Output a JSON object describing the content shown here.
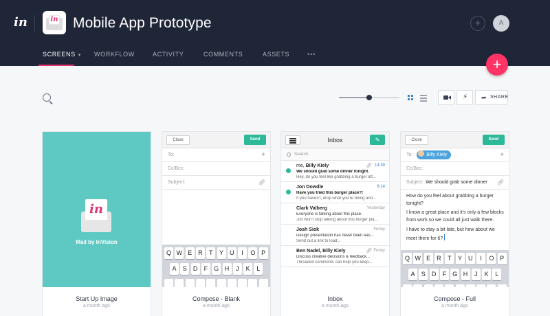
{
  "header": {
    "logo_text": "in",
    "app_icon_letter": "in",
    "title": "Mobile App Prototype",
    "plus_label": "+",
    "avatar_initial": "A"
  },
  "nav": {
    "items": [
      {
        "label": "SCREENS",
        "active": true
      },
      {
        "label": "WORKFLOW",
        "active": false
      },
      {
        "label": "ACTIVITY",
        "active": false
      },
      {
        "label": "COMMENTS",
        "active": false
      },
      {
        "label": "ASSETS",
        "active": false
      }
    ],
    "more_label": "•••",
    "dropdown_glyph": "▾"
  },
  "fab": {
    "label": "+"
  },
  "toolbar": {
    "zoom_level": 0.5,
    "view_mode": "grid",
    "share_label": "SHARE",
    "icons": [
      "search-icon",
      "grid-view-icon",
      "list-view-icon",
      "video-icon",
      "lightning-icon",
      "share-arrow-icon"
    ]
  },
  "colors": {
    "header_bg": "#1f2637",
    "accent": "#e0336f",
    "fab": "#ff3366",
    "teal": "#5ec9c3",
    "send_green": "#2bb99a",
    "chip_blue": "#4aa3df"
  },
  "cards": [
    {
      "title": "Start Up Image",
      "meta": "a month ago",
      "splash_letter": "in",
      "splash_label": "Mail by InVision"
    },
    {
      "title": "Compose - Blank",
      "meta": "a month ago",
      "close_label": "Close",
      "send_label": "Send",
      "to_label": "To:",
      "cc_label": "Cc/Bcc:",
      "subject_label": "Subject:"
    },
    {
      "title": "Inbox",
      "meta": "a month ago",
      "header_title": "Inbox",
      "search_placeholder": "Search",
      "emails": [
        {
          "from_prefix": "me, ",
          "from": "Billy Kiely",
          "time": "14:39",
          "subject": "We should grab some dinner tonight.",
          "preview": "Hey, do you feel like grabbing a burger aft...",
          "unread": true,
          "attachment": true
        },
        {
          "from_prefix": "",
          "from": "Jon Dowdle",
          "time": "8:14",
          "subject": "Have you tried this burger place?!",
          "preview": "If you haven't, drop what you're doing and...",
          "unread": true,
          "attachment": false
        },
        {
          "from_prefix": "",
          "from": "Clark Valberg",
          "time": "Yesterday",
          "subject": "Everyone is talking about this place.",
          "preview": "Jon won't stop talking about this burger pla...",
          "unread": false,
          "attachment": false
        },
        {
          "from_prefix": "",
          "from": "Josh Siok",
          "time": "Friday",
          "subject": "Design presentation has never been eas...",
          "preview": "Send out a link to load...",
          "unread": false,
          "attachment": false
        },
        {
          "from_prefix": "",
          "from": "Ben Nadel, Billy Kiely",
          "time": "Friday",
          "subject": "Discuss creative decisions & feedback...",
          "preview": "Threaded comments can help you keep...",
          "unread": false,
          "attachment": true
        }
      ]
    },
    {
      "title": "Compose - Full",
      "meta": "a month ago",
      "close_label": "Close",
      "send_label": "Send",
      "to_label": "To:",
      "to_chip": "Billy Kiely",
      "cc_label": "Cc/Bcc:",
      "subject_label": "Subject:",
      "subject_value": "We should grab some dinner",
      "body": [
        "How do you feel about grabbing a burger tonight?",
        "I know a great place and it's only a few blocks from work so we could all just walk there.",
        "I have to stay a bit late, but how about we meet there for 6?"
      ]
    }
  ],
  "keyboard": {
    "row1": [
      "Q",
      "W",
      "E",
      "R",
      "T",
      "Y",
      "U",
      "I",
      "O",
      "P"
    ],
    "row2": [
      "A",
      "S",
      "D",
      "F",
      "G",
      "H",
      "J",
      "K",
      "L"
    ]
  }
}
